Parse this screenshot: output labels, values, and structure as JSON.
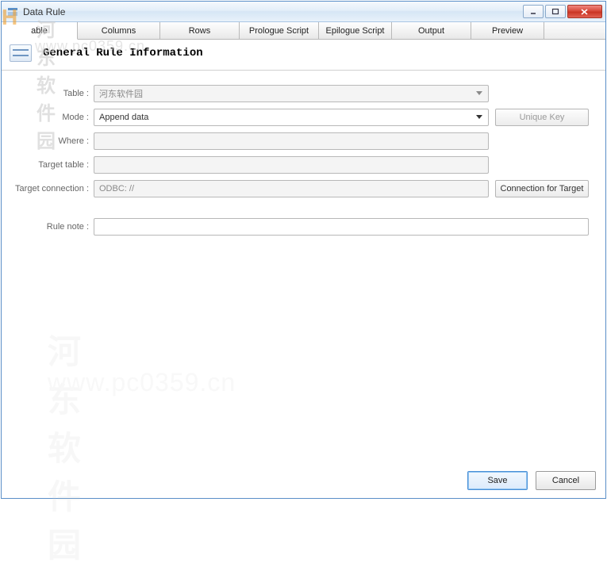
{
  "window": {
    "title": "Data Rule"
  },
  "tabs": [
    {
      "label": "able"
    },
    {
      "label": "Columns"
    },
    {
      "label": "Rows"
    },
    {
      "label": "Prologue Script"
    },
    {
      "label": "Epilogue Script"
    },
    {
      "label": "Output"
    },
    {
      "label": "Preview"
    }
  ],
  "section": {
    "title": "General Rule Information"
  },
  "form": {
    "table": {
      "label": "Table :",
      "value": "河东软件园"
    },
    "mode": {
      "label": "Mode :",
      "value": "Append data"
    },
    "where": {
      "label": "Where :",
      "value": ""
    },
    "target_table": {
      "label": "Target table :",
      "value": ""
    },
    "target_conn": {
      "label": "Target connection :",
      "value": "ODBC: //"
    },
    "rule_note": {
      "label": "Rule note :",
      "value": ""
    }
  },
  "buttons": {
    "unique_key": "Unique Key",
    "connection_for_target": "Connection for Target",
    "save": "Save",
    "cancel": "Cancel"
  },
  "watermark": {
    "brand": "河东软件园",
    "url": "www.pc0359.cn"
  }
}
